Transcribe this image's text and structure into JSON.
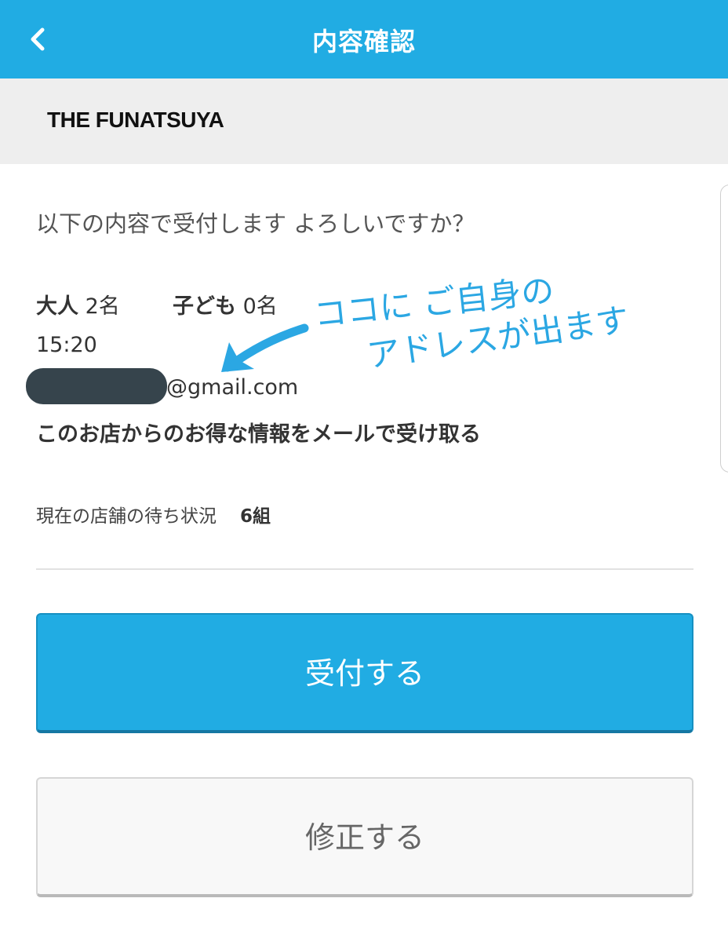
{
  "header": {
    "title": "内容確認",
    "back_icon": "chevron-left-icon"
  },
  "shop": {
    "name": "THE FUNATSUYA"
  },
  "confirm": {
    "question": "以下の内容で受付します よろしいですか？",
    "adults_label": "大人",
    "adults_count": "2名",
    "children_label": "子ども",
    "children_count": "0名",
    "time": "15:20",
    "email_domain": "@gmail.com",
    "promo": "このお店からのお得な情報をメールで受け取る"
  },
  "wait": {
    "label": "現在の店舗の待ち状況",
    "count": "6組"
  },
  "buttons": {
    "submit": "受付する",
    "edit": "修正する"
  },
  "annotation": {
    "line1": "ココに ご自身の",
    "line2": "アドレスが出ます"
  },
  "colors": {
    "accent": "#21ace3",
    "annotation": "#2ba7e3",
    "redaction": "#36444c"
  }
}
